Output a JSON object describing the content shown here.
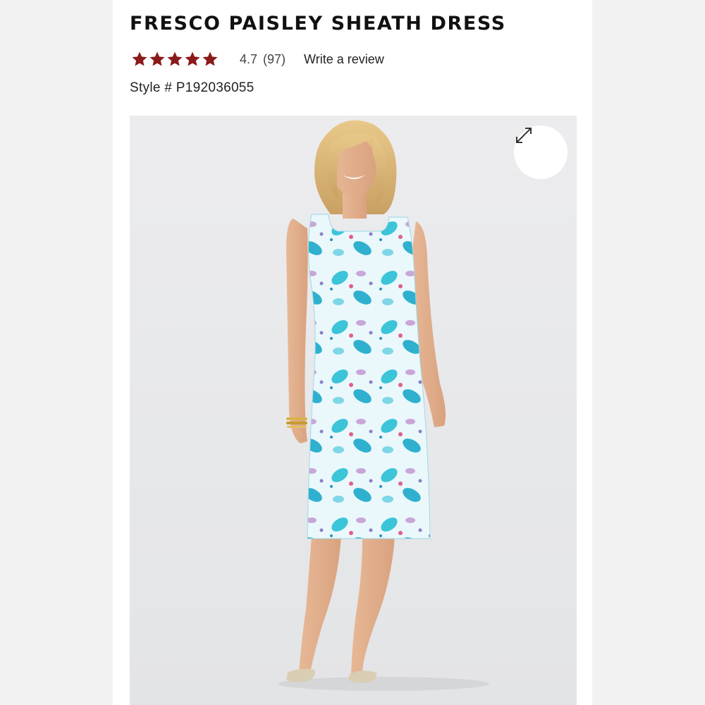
{
  "product": {
    "title": "FRESCO PAISLEY SHEATH DRESS",
    "rating": {
      "value": "4.7",
      "count": "(97)",
      "stars_filled_fraction": 0.94,
      "star_color": "#8b1a1a",
      "write_review_label": "Write a review"
    },
    "style_label": "Style # P192036055"
  },
  "gallery": {
    "image_alt": "Model wearing the paisley sheath dress",
    "expand_icon": "expand-arrows-icon"
  }
}
